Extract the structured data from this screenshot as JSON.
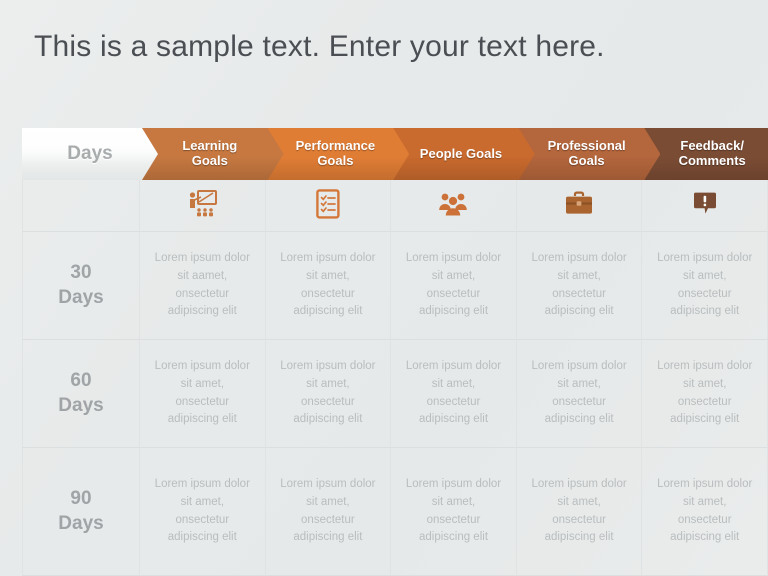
{
  "slide": {
    "title": "This is a sample text. Enter your text here.",
    "background_color": "#e8eaea"
  },
  "table": {
    "corner_header": {
      "label": "Days",
      "color": "#f2f3f3",
      "text_color": "#a8acad"
    },
    "columns": [
      {
        "label": "Learning\nGoals",
        "line1": "Learning",
        "line2": "Goals",
        "color": "#c67840",
        "icon": "presentation-icon"
      },
      {
        "label": "Performance\nGoals",
        "line1": "Performance",
        "line2": "Goals",
        "color": "#e07d35",
        "icon": "checklist-icon"
      },
      {
        "label": "People Goals",
        "line1": "People Goals",
        "line2": "",
        "color": "#c96a2e",
        "icon": "people-group-icon"
      },
      {
        "label": "Professional\nGoals",
        "line1": "Professional",
        "line2": "Goals",
        "color": "#b4663c",
        "icon": "briefcase-icon"
      },
      {
        "label": "Feedback/\nComments",
        "line1": "Feedback/",
        "line2": "Comments",
        "color": "#7b4c34",
        "icon": "comment-alert-icon"
      }
    ],
    "rows": [
      {
        "label_line1": "30",
        "label_line2": "Days",
        "cells": [
          "Lorem ipsum dolor sit aamet, onsectetur adipiscing elit",
          "Lorem ipsum dolor sit amet, onsectetur adipiscing elit",
          "Lorem ipsum dolor sit amet, onsectetur adipiscing elit",
          "Lorem ipsum dolor sit amet, onsectetur adipiscing elit",
          "Lorem ipsum dolor sit amet, onsectetur adipiscing elit"
        ]
      },
      {
        "label_line1": "60",
        "label_line2": "Days",
        "cells": [
          "Lorem ipsum dolor sit amet, onsectetur adipiscing elit",
          "Lorem ipsum dolor sit amet, onsectetur adipiscing elit",
          "Lorem ipsum dolor sit amet, onsectetur adipiscing elit",
          "Lorem ipsum dolor sit amet, onsectetur adipiscing elit",
          "Lorem ipsum dolor sit amet, onsectetur adipiscing elit"
        ]
      },
      {
        "label_line1": "90",
        "label_line2": "Days",
        "cells": [
          "Lorem ipsum dolor sit amet, onsectetur adipiscing elit",
          "Lorem ipsum dolor sit amet, onsectetur adipiscing elit",
          "Lorem ipsum dolor sit amet, onsectetur adipiscing elit",
          "Lorem ipsum dolor sit amet, onsectetur adipiscing elit",
          "Lorem ipsum dolor sit amet, onsectetur adipiscing elit"
        ]
      }
    ]
  }
}
